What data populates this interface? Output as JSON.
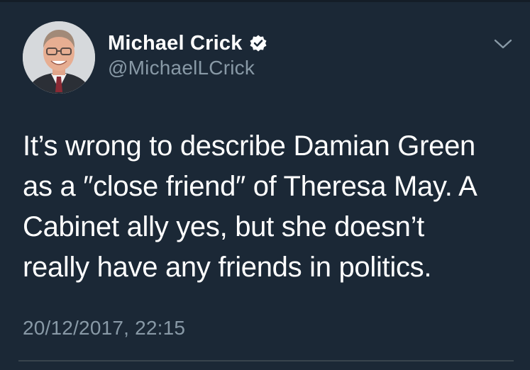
{
  "tweet": {
    "author": {
      "display_name": "Michael Crick",
      "handle": "@MichaelLCrick",
      "verified": true
    },
    "text": "It’s wrong to describe Damian Green\nas a ″close friend″ of Theresa May.  A\nCabinet ally yes, but she doesn’t\nreally have any friends in politics.",
    "timestamp": "20/12/2017, 22:15"
  },
  "icons": {
    "verified": "verified-badge-icon",
    "menu": "chevron-down-icon"
  },
  "colors": {
    "background": "#1b2836",
    "text_primary": "#ffffff",
    "text_secondary": "#8899a6",
    "divider": "#38444d"
  }
}
